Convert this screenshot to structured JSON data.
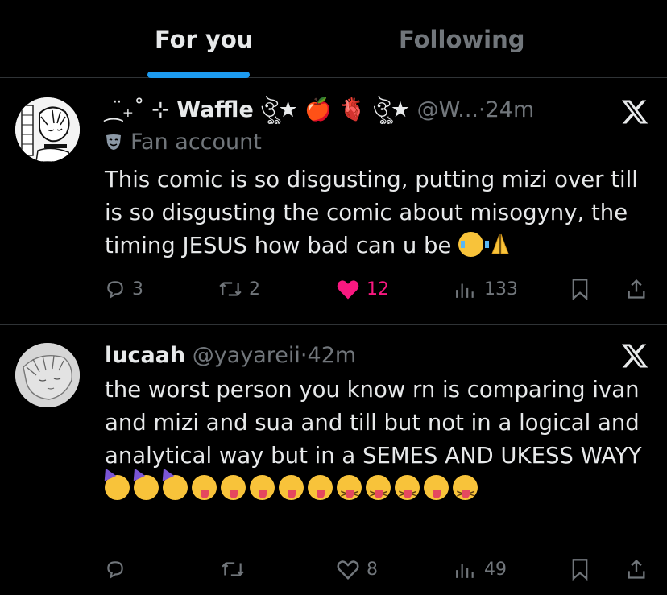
{
  "tabs": [
    {
      "label": "For you",
      "active": true
    },
    {
      "label": "Following",
      "active": false
    }
  ],
  "colors": {
    "accent": "#1d9bf0",
    "like": "#f91880",
    "muted": "#71767b",
    "text": "#e7e9ea",
    "divider": "#2f3336"
  },
  "tweets": [
    {
      "display_name": "Waffle",
      "name_prefix": "⁔̈₊˚ ⊹",
      "name_suffix": "ঔৣ★ 🍎 🫀 ঔৣ★",
      "handle": "@W...",
      "dot": "·",
      "time": "24m",
      "label_icon": "mask-icon",
      "label": "Fan account",
      "text": "This comic is so disgusting, putting mizi over till is so disgusting the comic about misogyny, the timing JESUS how bad can u be",
      "emojis": [
        "loudly-crying-face",
        "folded-hands"
      ],
      "replies": "3",
      "reposts": "2",
      "likes": "12",
      "liked": true,
      "views": "133"
    },
    {
      "display_name": "lucaah",
      "handle": "@yayareii",
      "dot": "·",
      "time": "42m",
      "text": "the worst person you know rn is comparing ivan and mizi and sua and till but not in a logical and analytical way but in a SEMES AND UKESS WAYY",
      "emojis": [
        "partying-face",
        "partying-face",
        "partying-face",
        "face-savoring-food",
        "face-savoring-food",
        "face-with-tongue",
        "face-with-tongue",
        "face-with-tongue",
        "squinting-face-with-tongue",
        "squinting-face-with-tongue",
        "squinting-face-with-tongue",
        "face-with-tongue",
        "squinting-face-with-tongue"
      ],
      "replies": "",
      "reposts": "",
      "likes": "8",
      "liked": false,
      "views": "49"
    }
  ]
}
